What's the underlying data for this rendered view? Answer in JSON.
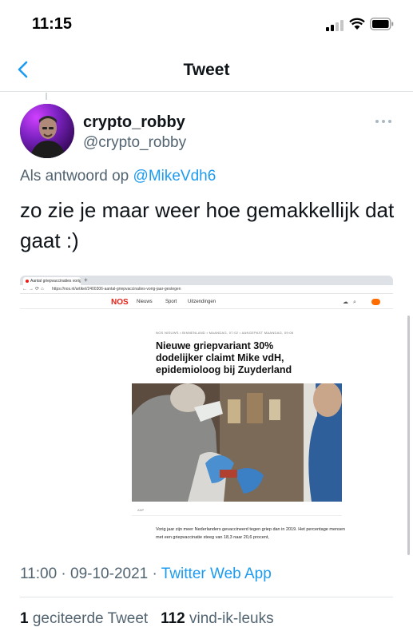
{
  "status_bar": {
    "time": "11:15"
  },
  "nav": {
    "title": "Tweet"
  },
  "tweet": {
    "display_name": "crypto_robby",
    "handle": "@crypto_robby",
    "reply_prefix": "Als antwoord op",
    "reply_to": "@MikeVdh6",
    "text": "zo zie je maar weer hoe gemakkellijk dat gaat :)",
    "time": "11:00",
    "date": "09-10-2021",
    "separator": "·",
    "source": "Twitter Web App",
    "retweets_count": "1",
    "retweets_label": "geciteerde Tweet",
    "likes_count": "112",
    "likes_label": "vind-ik-leuks"
  },
  "embedded_screenshot": {
    "tab_title": "Aantal griepvaccinaties vorig...",
    "url": "https://nos.nl/artikel/2400306-aantal-griepvaccinaties-vorig-jaar-gestegen",
    "logo": "NOS",
    "nav_items": [
      "Nieuws",
      "Sport",
      "Uitzendingen"
    ],
    "meta": "NOS NIEUWS  •  BINNENLAND  •  MAANDAG, 07:02  •  AANGEPAST MAANDAG, 09:06",
    "headline": "Nieuwe griepvariant 30% dodelijker claimt Mike vdH, epidemioloog bij Zuyderland",
    "caption": "ANP",
    "body": "Vorig jaar zijn meer Nederlanders gevaccineerd tegen griep dan in 2019. Het percentage mensen met een griepvaccinatie steeg van 18,3 naar 20,6 procent,"
  },
  "colors": {
    "link": "#1d9bf0",
    "secondary_text": "#536471",
    "nos_red": "#e61e14"
  },
  "icons": [
    "back-chevron-icon",
    "more-dots-icon",
    "cellular-signal-icon",
    "wifi-icon",
    "battery-icon"
  ]
}
